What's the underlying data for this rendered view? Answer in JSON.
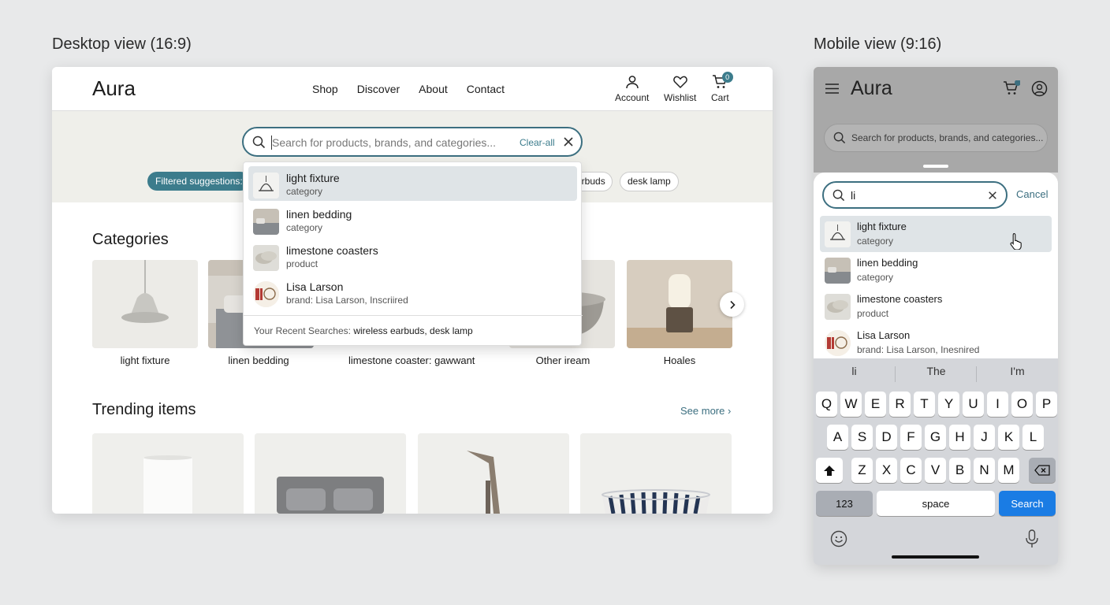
{
  "labels": {
    "desktop": "Desktop view (16:9)",
    "mobile": "Mobile view (9:16)"
  },
  "desktop": {
    "brand": "Aura",
    "nav": [
      "Shop",
      "Discover",
      "About",
      "Contact"
    ],
    "actions": {
      "account": "Account",
      "wishlist": "Wishlist",
      "cart": "Cart",
      "cart_count": "0"
    },
    "search": {
      "placeholder": "Search for products, brands, and categories...",
      "clear_label": "Clear-all"
    },
    "filtered_label": "Filtered suggestions:",
    "pills": [
      "arbuds",
      "desk lamp"
    ],
    "suggestions": [
      {
        "title": "light fixture",
        "subtitle": "category"
      },
      {
        "title": "linen bedding",
        "subtitle": "category"
      },
      {
        "title": "limestone coasters",
        "subtitle": "product"
      },
      {
        "title": "Lisa Larson",
        "subtitle": "brand: Lisa Larson, Inscriired"
      }
    ],
    "recent": {
      "label": "Your Recent Searches:",
      "items": [
        "wireless earbuds,",
        "desk lamp"
      ]
    },
    "categories": {
      "title": "Categories",
      "items": [
        "light fixture",
        "linen bedding",
        "limestone coaster: gawwant",
        "Other iream",
        "Hoales"
      ]
    },
    "trending": {
      "title": "Trending items",
      "see_more": "See more"
    }
  },
  "mobile": {
    "brand": "Aura",
    "search_placeholder": "Search for products, brands, and categories...",
    "query": "li",
    "cancel": "Cancel",
    "suggestions": [
      {
        "title": "light fixture",
        "subtitle": "category"
      },
      {
        "title": "linen bedding",
        "subtitle": "category"
      },
      {
        "title": "limestone coasters",
        "subtitle": "product"
      },
      {
        "title": "Lisa Larson",
        "subtitle": "brand: Lisa Larson, Inesnired"
      }
    ],
    "predictions": [
      "li",
      "The",
      "I'm"
    ],
    "keyboard": {
      "row1": [
        "Q",
        "W",
        "E",
        "R",
        "T",
        "Y",
        "U",
        "I",
        "O",
        "P"
      ],
      "row2": [
        "A",
        "S",
        "D",
        "F",
        "G",
        "H",
        "J",
        "K",
        "L"
      ],
      "row3": [
        "Z",
        "X",
        "C",
        "V",
        "B",
        "N",
        "M"
      ],
      "numbers": "123",
      "space": "space",
      "search": "Search"
    }
  },
  "colors": {
    "accent": "#3c6f80",
    "accent_fill": "#3c7c8c",
    "keyboard_action": "#1a7ce4"
  },
  "icons": [
    "search-icon",
    "clear-icon",
    "user-icon",
    "heart-icon",
    "cart-icon",
    "menu-icon",
    "chevron-right-icon",
    "shift-icon",
    "backspace-icon",
    "emoji-icon",
    "microphone-icon",
    "pointer-cursor-icon"
  ]
}
